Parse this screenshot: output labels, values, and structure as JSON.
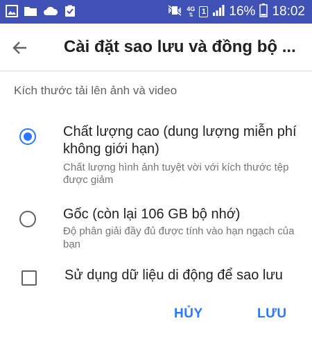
{
  "status_bar": {
    "icons_left": [
      "image-icon",
      "folder-icon",
      "cloud-icon",
      "clipboard-check-icon"
    ],
    "network_label": "4G",
    "sim_label": "1",
    "battery": "16%",
    "time": "18:02",
    "background_color": "#3f51b5"
  },
  "toolbar": {
    "back_icon": "arrow-back-icon",
    "title": "Cài đặt sao lưu và đồng bộ ..."
  },
  "section": {
    "header": "Kích thước tải lên ảnh và video",
    "options": [
      {
        "title_line1": "Chất lượng cao (dung lượng miễn phí",
        "title_line2": "không giới hạn)",
        "subtitle_line1": "Chất lượng hình ảnh tuyệt vời với kích thước tệp",
        "subtitle_line2": "được giảm",
        "selected": true
      },
      {
        "title_line1": "Gốc (còn lại 106 GB bộ nhớ)",
        "subtitle_line1": "Độ phân giải đầy đủ được tính vào hạn ngạch của",
        "subtitle_line2": "bạn",
        "selected": false
      }
    ],
    "mobile_data": {
      "label": "Sử dụng dữ liệu di động để sao lưu",
      "checked": false
    }
  },
  "buttons": {
    "cancel": "HỦY",
    "save": "LƯU"
  },
  "accent_color": "#2979ff"
}
